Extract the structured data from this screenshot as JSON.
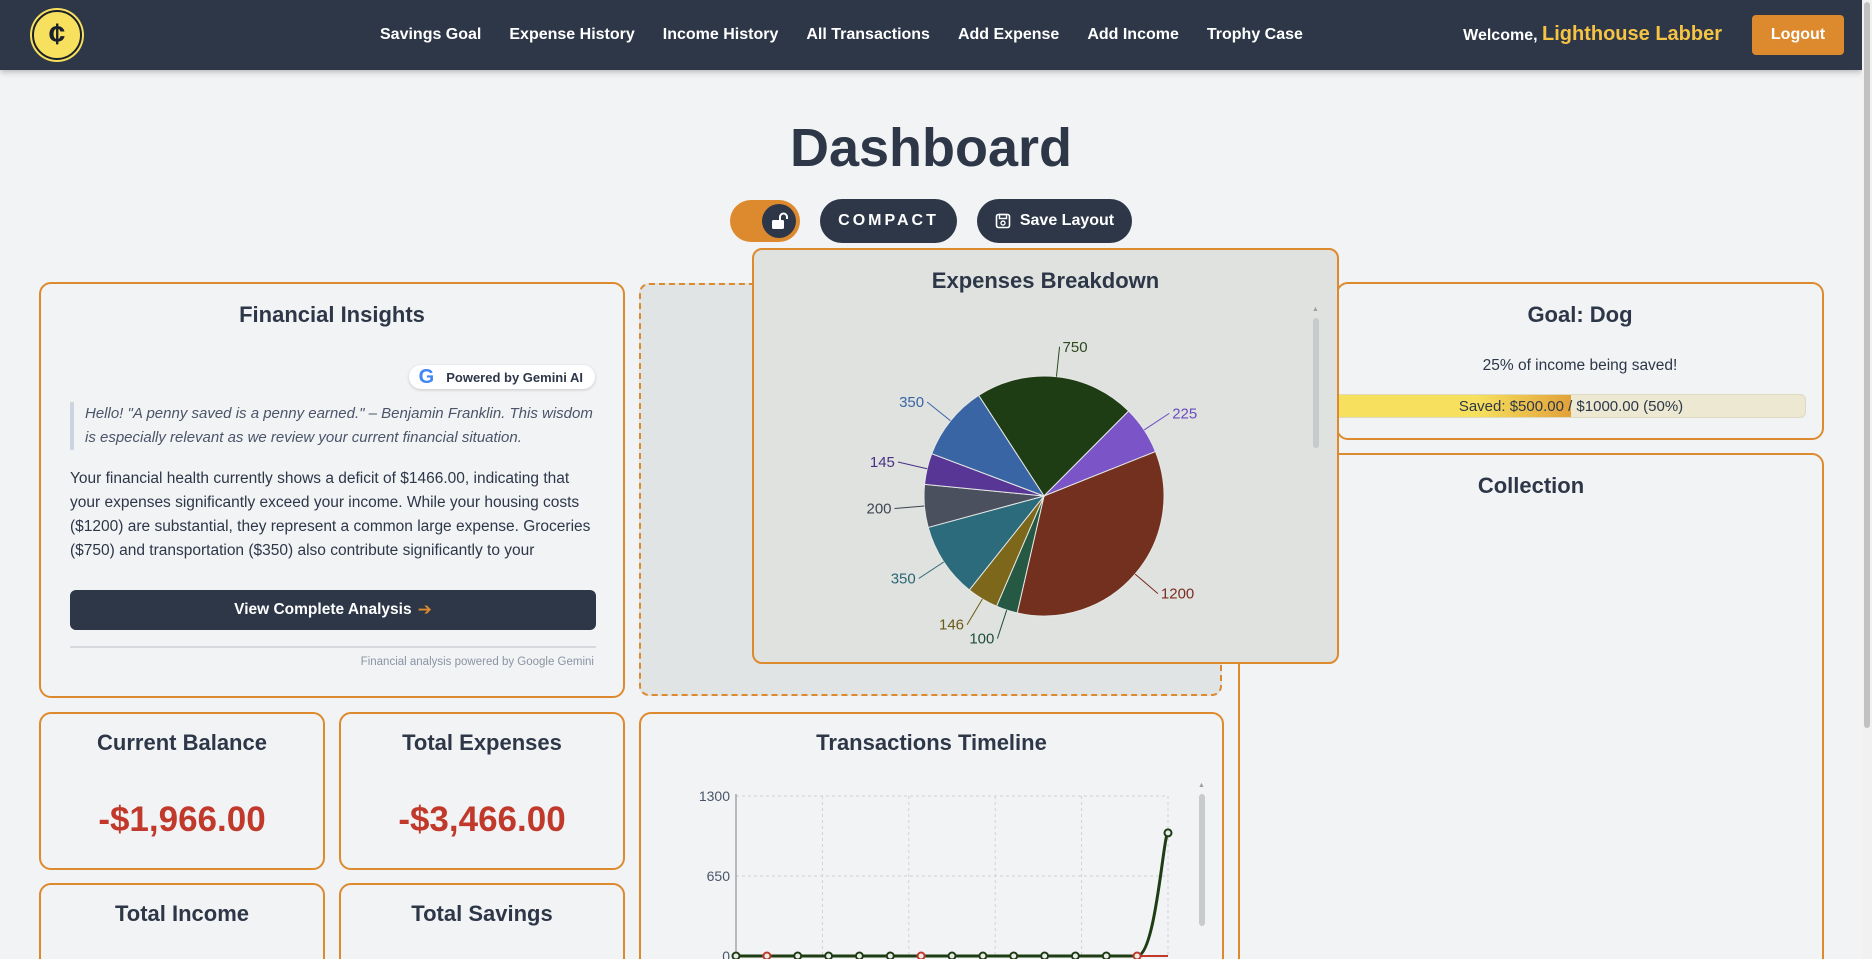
{
  "nav": {
    "logo_glyph": "¢",
    "links": [
      "Savings Goal",
      "Expense History",
      "Income History",
      "All Transactions",
      "Add Expense",
      "Add Income",
      "Trophy Case"
    ],
    "welcome_label": "Welcome,",
    "username": "Lighthouse Labber",
    "logout_label": "Logout"
  },
  "page": {
    "title": "Dashboard",
    "compact_label": "COMPACT",
    "save_layout_label": "Save Layout",
    "lock_icon": "unlock-icon"
  },
  "insights": {
    "title": "Financial Insights",
    "badge_label": "Powered by Gemini AI",
    "quote": "Hello! \"A penny saved is a penny earned.\" – Benjamin Franklin. This wisdom is especially relevant as we review your current financial situation.",
    "analysis": "Your financial health currently shows a deficit of $1466.00, indicating that your expenses significantly exceed your income. While your housing costs ($1200) are substantial, they represent a common large expense. Groceries ($750) and transportation ($350) also contribute significantly to your overspending. Your savings goal for your dog is commendable, showing a",
    "view_button": "View Complete Analysis",
    "footnote": "Financial analysis powered by Google Gemini"
  },
  "breakdown": {
    "title": "Expenses Breakdown"
  },
  "goal": {
    "title": "Goal: Dog",
    "subtitle": "25% of income being saved!",
    "progress_text": "Saved: $500.00 / $1000.00 (50%)",
    "progress_fraction": 0.5
  },
  "collection": {
    "title": "Collection"
  },
  "stats": {
    "balance_title": "Current Balance",
    "balance_value": "-$1,966.00",
    "expenses_title": "Total Expenses",
    "expenses_value": "-$3,466.00",
    "income_title": "Total Income",
    "savings_title": "Total Savings"
  },
  "timeline": {
    "title": "Transactions Timeline"
  },
  "chart_data": [
    {
      "type": "pie",
      "title": "Expenses Breakdown",
      "values": [
        750,
        225,
        1200,
        100,
        146,
        350,
        200,
        145,
        350
      ],
      "colors": [
        "#1f3d14",
        "#7b55c7",
        "#74301f",
        "#255943",
        "#7d671a",
        "#2b6b7b",
        "#4a505d",
        "#573695",
        "#3a65a5"
      ],
      "label_colors": [
        "#2d4a1e",
        "#6b4bbf",
        "#7a2e20",
        "#1f4d3a",
        "#6b5a14",
        "#2b6675",
        "#3f4552",
        "#4a2f85",
        "#3a65a5"
      ]
    },
    {
      "type": "line",
      "title": "Transactions Timeline",
      "yticks": [
        0,
        650,
        1300
      ],
      "ylim": [
        0,
        1300
      ],
      "series": [
        {
          "values": [
            0,
            0,
            0,
            0,
            0,
            0,
            0,
            0,
            0,
            0,
            0,
            0,
            0,
            0,
            1000
          ],
          "color": "#1f3d14"
        },
        {
          "values": [
            0,
            0,
            0,
            0,
            0,
            0,
            0,
            0,
            0,
            0,
            0,
            0,
            0,
            0,
            0
          ],
          "color": "#c0392b"
        }
      ],
      "marker_color": "#1f3d14",
      "red_marker_indices": [
        1,
        6,
        13
      ]
    }
  ]
}
